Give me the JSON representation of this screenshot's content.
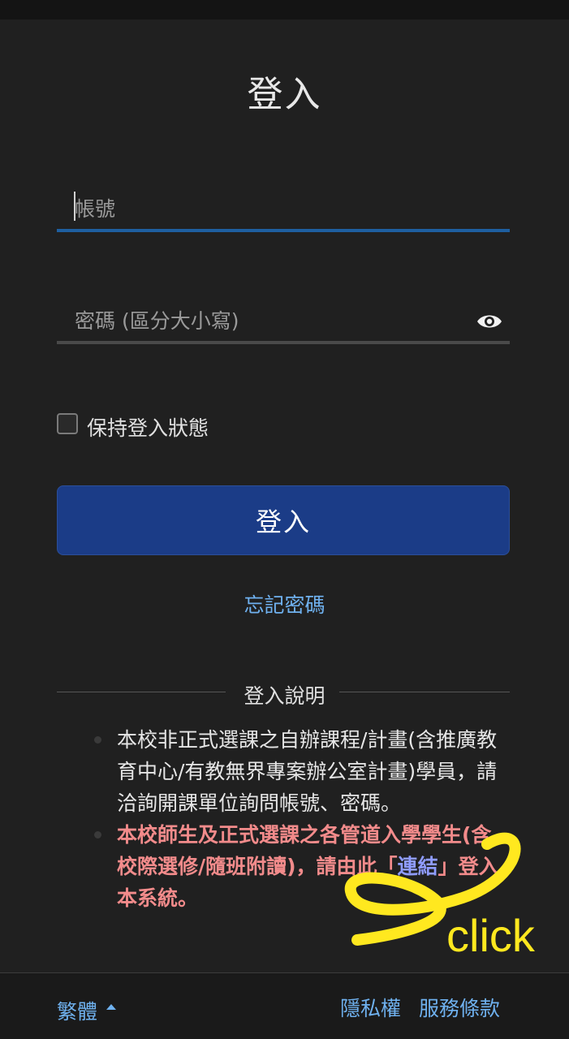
{
  "title": "登入",
  "username": {
    "placeholder": "帳號"
  },
  "password": {
    "placeholder": "密碼 (區分大小寫)",
    "toggle_icon": "eye-icon"
  },
  "remember": {
    "label": "保持登入狀態"
  },
  "login_button": "登入",
  "forgot_link": "忘記密碼",
  "help": {
    "title": "登入說明",
    "note1": "本校非正式選課之自辦課程/計畫(含推廣教育中心/有教無界專案辦公室計畫)學員，請洽詢開課單位詢問帳號、密碼。",
    "note2_before": "本校師生及正式選課之各管道入學學生(含校際選修/隨班附讀)，請由此「",
    "note2_link": "連結",
    "note2_after": "」登入本系統。"
  },
  "annotation": {
    "text": "click",
    "color": "#ffe81f"
  },
  "footer": {
    "language": "繁體",
    "privacy": "隱私權",
    "terms": "服務條款"
  },
  "colors": {
    "background": "#202020",
    "accent": "#1b3c87",
    "link": "#6fb1ef",
    "warning": "#f28b8b"
  }
}
